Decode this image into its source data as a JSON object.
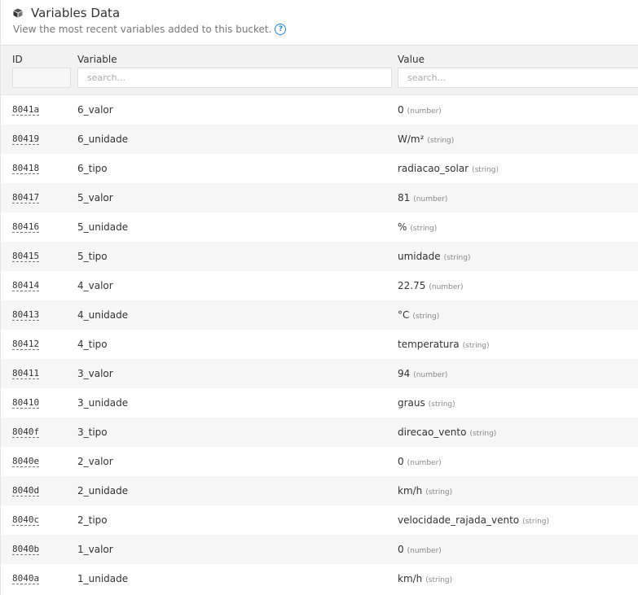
{
  "header": {
    "title": "Variables Data",
    "subtitle": "View the most recent variables added to this bucket.",
    "title_icon": "cube-icon",
    "help_icon": "help-circle-icon"
  },
  "table": {
    "columns": [
      "ID",
      "Variable",
      "Value"
    ],
    "filters": {
      "variable_placeholder": "search...",
      "value_placeholder": "search..."
    },
    "rows": [
      {
        "id": "8041a",
        "variable": "6_valor",
        "value": "0",
        "type": "(number)"
      },
      {
        "id": "80419",
        "variable": "6_unidade",
        "value": "W/m²",
        "type": "(string)"
      },
      {
        "id": "80418",
        "variable": "6_tipo",
        "value": "radiacao_solar",
        "type": "(string)"
      },
      {
        "id": "80417",
        "variable": "5_valor",
        "value": "81",
        "type": "(number)"
      },
      {
        "id": "80416",
        "variable": "5_unidade",
        "value": "%",
        "type": "(string)"
      },
      {
        "id": "80415",
        "variable": "5_tipo",
        "value": "umidade",
        "type": "(string)"
      },
      {
        "id": "80414",
        "variable": "4_valor",
        "value": "22.75",
        "type": "(number)"
      },
      {
        "id": "80413",
        "variable": "4_unidade",
        "value": "°C",
        "type": "(string)"
      },
      {
        "id": "80412",
        "variable": "4_tipo",
        "value": "temperatura",
        "type": "(string)"
      },
      {
        "id": "80411",
        "variable": "3_valor",
        "value": "94",
        "type": "(number)"
      },
      {
        "id": "80410",
        "variable": "3_unidade",
        "value": "graus",
        "type": "(string)"
      },
      {
        "id": "8040f",
        "variable": "3_tipo",
        "value": "direcao_vento",
        "type": "(string)"
      },
      {
        "id": "8040e",
        "variable": "2_valor",
        "value": "0",
        "type": "(number)"
      },
      {
        "id": "8040d",
        "variable": "2_unidade",
        "value": "km/h",
        "type": "(string)"
      },
      {
        "id": "8040c",
        "variable": "2_tipo",
        "value": "velocidade_rajada_vento",
        "type": "(string)"
      },
      {
        "id": "8040b",
        "variable": "1_valor",
        "value": "0",
        "type": "(number)"
      },
      {
        "id": "8040a",
        "variable": "1_unidade",
        "value": "km/h",
        "type": "(string)"
      }
    ]
  }
}
